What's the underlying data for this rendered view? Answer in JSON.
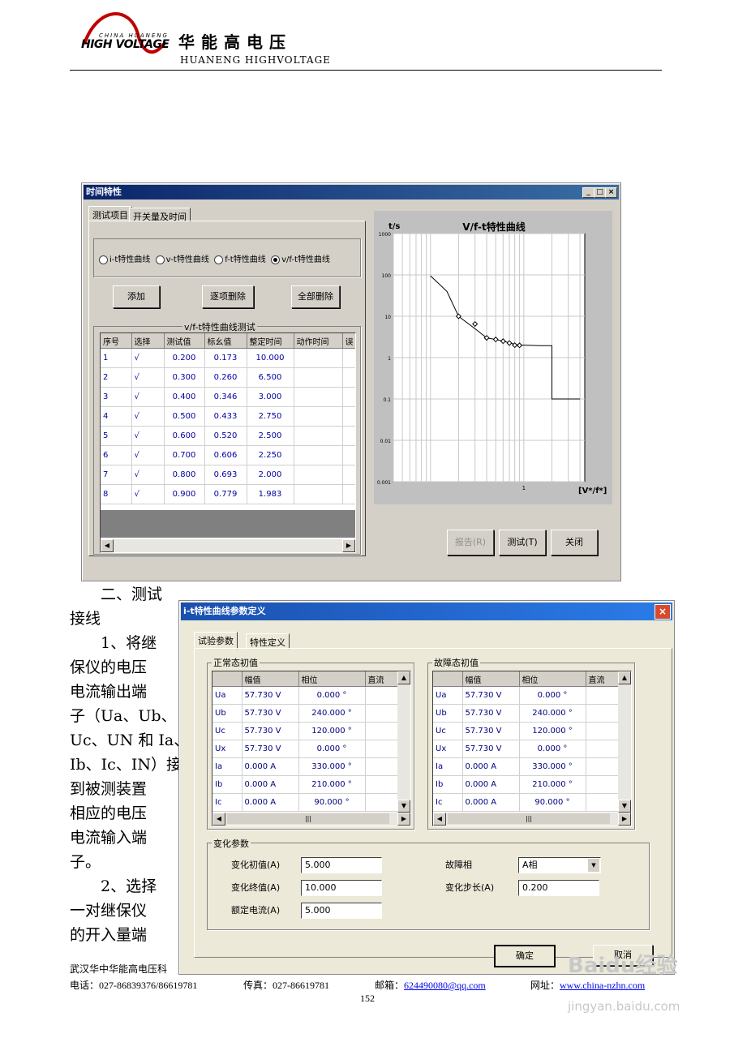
{
  "header": {
    "logo_small": "CHINA HUANENG",
    "logo_main": "HIGH VOLTAGE",
    "company_cn": "华能高电压",
    "company_en": "HUANENG HIGHVOLTAGE"
  },
  "win1": {
    "title": "时间特性",
    "ctrl_min": "_",
    "ctrl_max": "□",
    "ctrl_close": "×",
    "tabs": [
      "测试项目",
      "开关量及时间"
    ],
    "radios": [
      {
        "label": "i-t特性曲线",
        "selected": false
      },
      {
        "label": "v-t特性曲线",
        "selected": false
      },
      {
        "label": "f-t特性曲线",
        "selected": false
      },
      {
        "label": "v/f-t特性曲线",
        "selected": true
      }
    ],
    "btn_add": "添加",
    "btn_del_item": "逐项删除",
    "btn_del_all": "全部删除",
    "group_title": "v/f-t特性曲线测试",
    "table": {
      "headers": [
        "序号",
        "选择",
        "测试值",
        "标幺值",
        "整定时间",
        "动作时间",
        "误"
      ],
      "rows": [
        [
          "1",
          "√",
          "0.200",
          "0.173",
          "10.000",
          "",
          ""
        ],
        [
          "2",
          "√",
          "0.300",
          "0.260",
          "6.500",
          "",
          ""
        ],
        [
          "3",
          "√",
          "0.400",
          "0.346",
          "3.000",
          "",
          ""
        ],
        [
          "4",
          "√",
          "0.500",
          "0.433",
          "2.750",
          "",
          ""
        ],
        [
          "5",
          "√",
          "0.600",
          "0.520",
          "2.500",
          "",
          ""
        ],
        [
          "6",
          "√",
          "0.700",
          "0.606",
          "2.250",
          "",
          ""
        ],
        [
          "7",
          "√",
          "0.800",
          "0.693",
          "2.000",
          "",
          ""
        ],
        [
          "8",
          "√",
          "0.900",
          "0.779",
          "1.983",
          "",
          ""
        ]
      ]
    },
    "scroll_left": "◀",
    "scroll_right": "▶",
    "btn_report": "报告(R)",
    "btn_test": "测试(T)",
    "btn_close": "关闭",
    "chart_data": {
      "type": "line",
      "title": "V/f-t特性曲线",
      "ylabel": "t/s",
      "xlabel": "[V*/f*]",
      "y_scale": "log",
      "y_ticks": [
        "1000",
        "100",
        "10",
        "1",
        "0.1",
        "0.01",
        "0.001"
      ],
      "x_ticks": [
        "1"
      ],
      "grid": true,
      "curve_points": [
        [
          0.1,
          95
        ],
        [
          0.15,
          40
        ],
        [
          0.2,
          10
        ],
        [
          0.3,
          5
        ],
        [
          0.4,
          3
        ],
        [
          0.5,
          2.75
        ],
        [
          0.6,
          2.5
        ],
        [
          0.7,
          2.3
        ],
        [
          0.8,
          2.1
        ],
        [
          0.9,
          2.0
        ],
        [
          1.0,
          2.0
        ],
        [
          1.5,
          1.95
        ],
        [
          2.0,
          1.95
        ],
        [
          2.0,
          0.1
        ],
        [
          4.0,
          0.1
        ]
      ],
      "markers": [
        [
          0.2,
          10
        ],
        [
          0.3,
          6.5
        ],
        [
          0.4,
          3.0
        ],
        [
          0.5,
          2.75
        ],
        [
          0.6,
          2.5
        ],
        [
          0.7,
          2.25
        ],
        [
          0.8,
          2.0
        ],
        [
          0.9,
          1.983
        ]
      ]
    }
  },
  "body_text": [
    "二、测试",
    "接线",
    "1、将继",
    "保仪的电压",
    "电流输出端",
    "子（Ua、Ub、",
    "Uc、UN 和 Ia、",
    "Ib、Ic、IN）接",
    "到被测装置",
    "相应的电压",
    "电流输入端",
    "子。",
    "2、选择",
    "一对继保仪",
    "的开入量端"
  ],
  "win2": {
    "title": "i-t特性曲线参数定义",
    "ctrl_close": "×",
    "tabs": [
      "试验参数",
      "特性定义"
    ],
    "normal_title": "正常态初值",
    "fault_title": "故障态初值",
    "grid_headers": [
      "",
      "幅值",
      "相位",
      "直流"
    ],
    "normal_rows": [
      [
        "Ua",
        "57.730 V",
        "0.000 °",
        ""
      ],
      [
        "Ub",
        "57.730 V",
        "240.000 °",
        ""
      ],
      [
        "Uc",
        "57.730 V",
        "120.000 °",
        ""
      ],
      [
        "Ux",
        "57.730 V",
        "0.000 °",
        ""
      ],
      [
        "Ia",
        "0.000 A",
        "330.000 °",
        ""
      ],
      [
        "Ib",
        "0.000 A",
        "210.000 °",
        ""
      ],
      [
        "Ic",
        "0.000 A",
        "90.000 °",
        ""
      ]
    ],
    "fault_rows": [
      [
        "Ua",
        "57.730 V",
        "0.000 °",
        ""
      ],
      [
        "Ub",
        "57.730 V",
        "240.000 °",
        ""
      ],
      [
        "Uc",
        "57.730 V",
        "120.000 °",
        ""
      ],
      [
        "Ux",
        "57.730 V",
        "0.000 °",
        ""
      ],
      [
        "Ia",
        "0.000 A",
        "330.000 °",
        ""
      ],
      [
        "Ib",
        "0.000 A",
        "210.000 °",
        ""
      ],
      [
        "Ic",
        "0.000 A",
        "90.000 °",
        ""
      ]
    ],
    "scroll_up": "▲",
    "scroll_down": "▼",
    "scroll_left": "◀",
    "scroll_right": "▶",
    "scroll_grip": "|||",
    "change_title": "变化参数",
    "init_label": "变化初值(A)",
    "init_value": "5.000",
    "end_label": "变化终值(A)",
    "end_value": "10.000",
    "rated_label": "额定电流(A)",
    "rated_value": "5.000",
    "fault_phase_label": "故障相",
    "fault_phase_value": "A相",
    "step_label": "变化步长(A)",
    "step_value": "0.200",
    "btn_ok": "确定",
    "btn_cancel": "取消"
  },
  "footer": {
    "company": "武汉华中华能高电压科",
    "phone": "电话：027-86839376/86619781",
    "fax": "传真：027-86619781",
    "email_label": "邮箱：",
    "email": "624490080@qq.com",
    "web_label": "网址：",
    "web": "www.china-nzhn.com",
    "page": "152"
  },
  "watermark": {
    "brand": "Baidu经验",
    "url": "jingyan.baidu.com"
  }
}
